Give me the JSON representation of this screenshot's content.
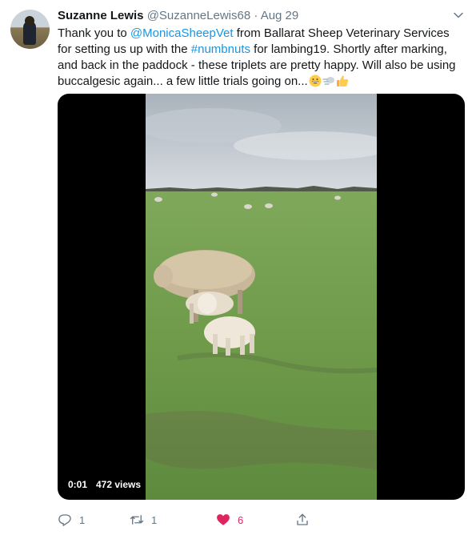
{
  "tweet": {
    "author_name": "Suzanne Lewis",
    "author_handle": "@SuzanneLewis68",
    "separator": "·",
    "date": "Aug 29",
    "text_1": "Thank you to ",
    "mention": "@MonicaSheepVet",
    "text_2": " from Ballarat Sheep Veterinary Services for setting us up with the ",
    "hashtag": "#numbnuts",
    "text_3": " for lambing19. Shortly after marking, and back in the paddock - these triplets are pretty happy. Will also be using buccalgesic again... a few little trials going on...",
    "emojis": [
      "grinning-face",
      "cloud-with-wind",
      "thumbs-up"
    ]
  },
  "video": {
    "elapsed": "0:01",
    "views": "472 views"
  },
  "actions": {
    "reply_count": "1",
    "retweet_count": "1",
    "like_count": "6",
    "share_label": ""
  },
  "colors": {
    "link": "#1b95e0",
    "secondary_text": "#657786",
    "like": "#e0245e"
  }
}
